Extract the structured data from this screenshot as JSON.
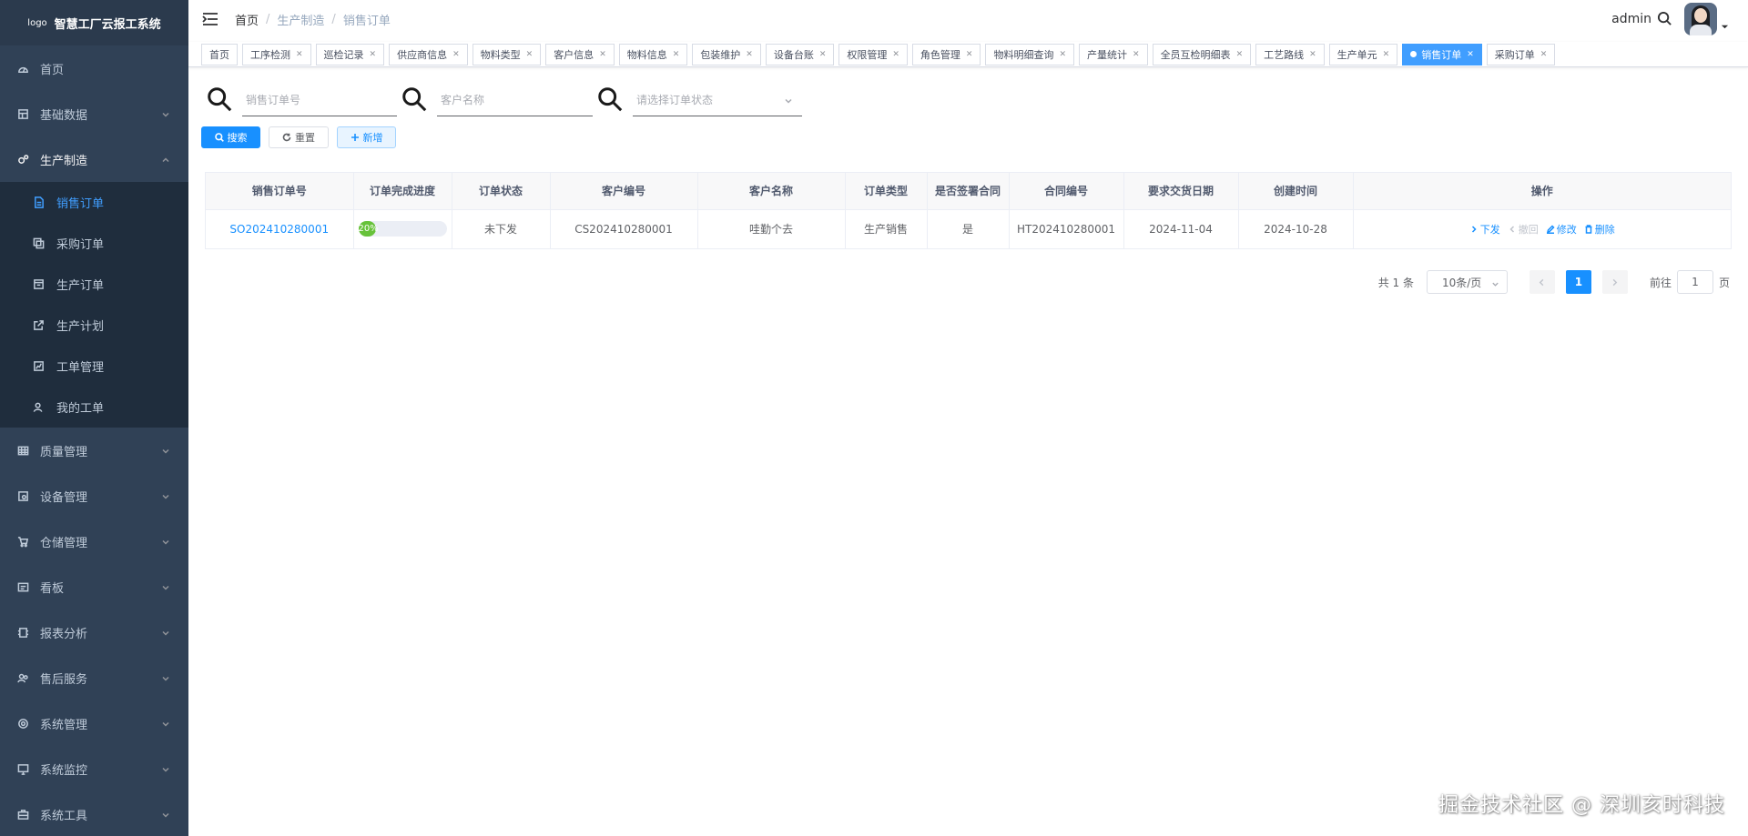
{
  "sidebar": {
    "logo_text": "logo",
    "title": "智慧工厂云报工系统",
    "menu": [
      {
        "label": "首页",
        "icon": "dashboard-icon",
        "expandable": false
      },
      {
        "label": "基础数据",
        "icon": "database-icon",
        "expandable": true
      },
      {
        "label": "生产制造",
        "icon": "gears-icon",
        "expandable": true,
        "open": true,
        "children": [
          {
            "label": "销售订单",
            "icon": "document-icon",
            "active": true
          },
          {
            "label": "采购订单",
            "icon": "copy-icon"
          },
          {
            "label": "生产订单",
            "icon": "calendar-icon"
          },
          {
            "label": "生产计划",
            "icon": "external-link-icon"
          },
          {
            "label": "工单管理",
            "icon": "chart-icon"
          },
          {
            "label": "我的工单",
            "icon": "user-icon"
          }
        ]
      },
      {
        "label": "质量管理",
        "icon": "table-icon",
        "expandable": true
      },
      {
        "label": "设备管理",
        "icon": "device-icon",
        "expandable": true
      },
      {
        "label": "仓储管理",
        "icon": "cart-icon",
        "expandable": true
      },
      {
        "label": "看板",
        "icon": "board-icon",
        "expandable": true
      },
      {
        "label": "报表分析",
        "icon": "report-icon",
        "expandable": true
      },
      {
        "label": "售后服务",
        "icon": "people-icon",
        "expandable": true
      },
      {
        "label": "系统管理",
        "icon": "settings-icon",
        "expandable": true
      },
      {
        "label": "系统监控",
        "icon": "monitor-icon",
        "expandable": true
      },
      {
        "label": "系统工具",
        "icon": "toolbox-icon",
        "expandable": true
      }
    ]
  },
  "navbar": {
    "breadcrumb": [
      "首页",
      "生产制造",
      "销售订单"
    ],
    "username": "admin"
  },
  "tags": [
    {
      "label": "首页",
      "closable": false
    },
    {
      "label": "工序检测",
      "closable": true
    },
    {
      "label": "巡检记录",
      "closable": true
    },
    {
      "label": "供应商信息",
      "closable": true
    },
    {
      "label": "物料类型",
      "closable": true
    },
    {
      "label": "客户信息",
      "closable": true
    },
    {
      "label": "物料信息",
      "closable": true
    },
    {
      "label": "包装维护",
      "closable": true
    },
    {
      "label": "设备台账",
      "closable": true
    },
    {
      "label": "权限管理",
      "closable": true
    },
    {
      "label": "角色管理",
      "closable": true
    },
    {
      "label": "物料明细查询",
      "closable": true
    },
    {
      "label": "产量统计",
      "closable": true
    },
    {
      "label": "全员互检明细表",
      "closable": true
    },
    {
      "label": "工艺路线",
      "closable": true
    },
    {
      "label": "生产单元",
      "closable": true
    },
    {
      "label": "销售订单",
      "closable": true,
      "active": true
    },
    {
      "label": "采购订单",
      "closable": true
    }
  ],
  "search": {
    "order_no_placeholder": "销售订单号",
    "customer_placeholder": "客户名称",
    "status_placeholder": "请选择订单状态",
    "search_label": "搜索",
    "reset_label": "重置",
    "add_label": "新增"
  },
  "table": {
    "columns": [
      "销售订单号",
      "订单完成进度",
      "订单状态",
      "客户编号",
      "客户名称",
      "订单类型",
      "是否签署合同",
      "合同编号",
      "要求交货日期",
      "创建时间",
      "操作"
    ],
    "rows": [
      {
        "order_no": "SO202410280001",
        "progress": 20,
        "progress_text": "20%",
        "status": "未下发",
        "customer_no": "CS202410280001",
        "customer_name": "哇勤个去",
        "order_type": "生产销售",
        "contract_signed": "是",
        "contract_no": "HT202410280001",
        "delivery_date": "2024-11-04",
        "created": "2024-10-28",
        "actions": {
          "issue": "下发",
          "withdraw": "撤回",
          "edit": "修改",
          "delete": "删除"
        }
      }
    ]
  },
  "pagination": {
    "total": "共 1 条",
    "page_size": "10条/页",
    "current": "1",
    "goto_label": "前往",
    "goto_value": "1",
    "page_suffix": "页"
  },
  "watermark": "掘金技术社区 @ 深圳亥时科技",
  "colors": {
    "sidebar": "#304156",
    "primary": "#1890ff",
    "active_menu": "#409eff",
    "progress": "#67c23a"
  }
}
